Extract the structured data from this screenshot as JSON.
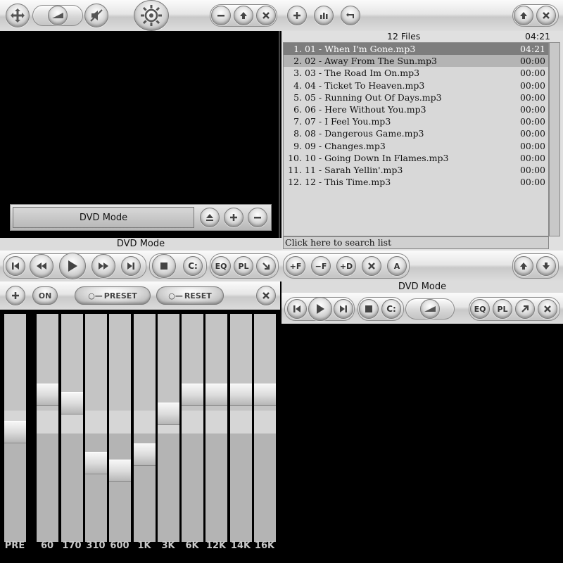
{
  "top_panel": {
    "mode_label": "DVD Mode",
    "caption": "DVD Mode"
  },
  "playlist": {
    "header_count": "12 Files",
    "header_time": "04:21",
    "items": [
      {
        "num": "1.",
        "title": "01 - When I'm Gone.mp3",
        "duration": "04:21"
      },
      {
        "num": "2.",
        "title": "02 - Away From The Sun.mp3",
        "duration": "00:00"
      },
      {
        "num": "3.",
        "title": "03 - The Road Im On.mp3",
        "duration": "00:00"
      },
      {
        "num": "4.",
        "title": "04 - Ticket To Heaven.mp3",
        "duration": "00:00"
      },
      {
        "num": "5.",
        "title": "05 - Running Out Of Days.mp3",
        "duration": "00:00"
      },
      {
        "num": "6.",
        "title": "06 - Here Without You.mp3",
        "duration": "00:00"
      },
      {
        "num": "7.",
        "title": "07 - I Feel You.mp3",
        "duration": "00:00"
      },
      {
        "num": "8.",
        "title": "08 - Dangerous Game.mp3",
        "duration": "00:00"
      },
      {
        "num": "9.",
        "title": "09 - Changes.mp3",
        "duration": "00:00"
      },
      {
        "num": "10.",
        "title": "10 - Going Down In Flames.mp3",
        "duration": "00:00"
      },
      {
        "num": "11.",
        "title": "11 - Sarah Yellin'.mp3",
        "duration": "00:00"
      },
      {
        "num": "12.",
        "title": "12 - This Time.mp3",
        "duration": "00:00"
      }
    ],
    "search_text": "Click here to search list"
  },
  "transport": {
    "drive_label": "C:",
    "eq_label": "EQ",
    "pl_label": "PL"
  },
  "playlist_controls": {
    "add_file": "+F",
    "remove_file": "−F",
    "add_dir": "+D",
    "all_label": "A"
  },
  "equalizer": {
    "on_label": "ON",
    "preset_label": "PRESET",
    "reset_label": "RESET",
    "bands": [
      {
        "label": "PRE",
        "level": 0.48
      },
      {
        "label": "60",
        "level": 0.66
      },
      {
        "label": "170",
        "level": 0.62
      },
      {
        "label": "310",
        "level": 0.33
      },
      {
        "label": "600",
        "level": 0.29
      },
      {
        "label": "1K",
        "level": 0.37
      },
      {
        "label": "3K",
        "level": 0.57
      },
      {
        "label": "6K",
        "level": 0.66
      },
      {
        "label": "12K",
        "level": 0.66
      },
      {
        "label": "14K",
        "level": 0.66
      },
      {
        "label": "16K",
        "level": 0.66
      }
    ]
  },
  "mini_player": {
    "title": "DVD Mode",
    "drive_label": "C:",
    "eq_label": "EQ",
    "pl_label": "PL"
  }
}
